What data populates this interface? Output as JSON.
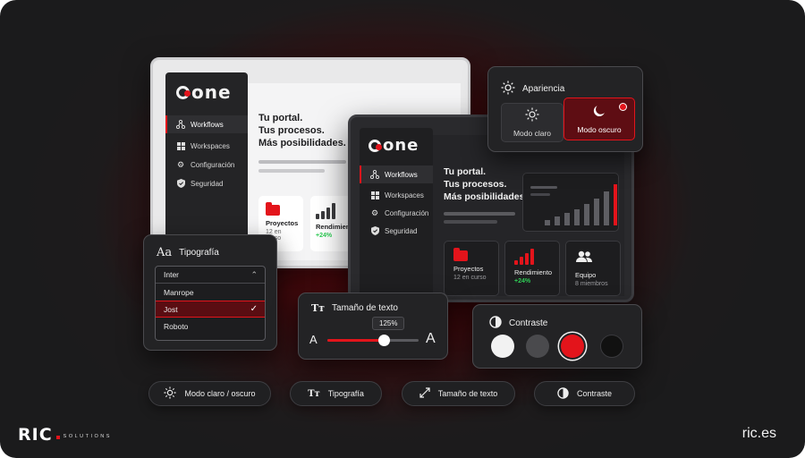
{
  "brand": {
    "app_logo": "one",
    "footer_logo": "RIC",
    "footer_logo_sub": "SOLUTIONS",
    "site": "ric.es",
    "accent_color": "#e3141b"
  },
  "light_window": {
    "nav": [
      {
        "label": "Workflows",
        "icon": "workflow-icon",
        "active": true
      },
      {
        "label": "Workspaces",
        "icon": "grid-icon",
        "active": false
      },
      {
        "label": "Configuración",
        "icon": "gear-icon",
        "active": false
      },
      {
        "label": "Seguridad",
        "icon": "shield-icon",
        "active": false
      }
    ],
    "headline": [
      "Tu portal.",
      "Tus procesos.",
      "Más posibilidades."
    ],
    "cards": [
      {
        "title": "Proyectos",
        "sub": "12 en curso",
        "icon": "folder-icon"
      },
      {
        "title": "Rendimiento",
        "sub": "+24%",
        "icon": "bar-chart-icon"
      }
    ]
  },
  "dark_window": {
    "nav": [
      {
        "label": "Workflows",
        "icon": "workflow-icon",
        "active": true
      },
      {
        "label": "Workspaces",
        "icon": "grid-icon",
        "active": false
      },
      {
        "label": "Configuración",
        "icon": "gear-icon",
        "active": false
      },
      {
        "label": "Seguridad",
        "icon": "shield-icon",
        "active": false
      }
    ],
    "headline": [
      "Tu portal.",
      "Tus procesos.",
      "Más posibilidades."
    ],
    "cards": [
      {
        "title": "Proyectos",
        "sub": "12 en curso",
        "icon": "folder-icon"
      },
      {
        "title": "Rendimiento",
        "sub": "+24%",
        "icon": "bar-chart-icon"
      },
      {
        "title": "Equipo",
        "sub": "8 miembros",
        "icon": "users-icon"
      }
    ]
  },
  "appearance": {
    "title": "Apariencia",
    "light_label": "Modo claro",
    "dark_label": "Modo oscuro",
    "selected": "dark"
  },
  "typography": {
    "title": "Tipografía",
    "title_glyph": "Aa",
    "current": "Inter",
    "options": [
      "Manrope",
      "Jost",
      "Roboto"
    ],
    "selected": "Jost"
  },
  "text_size": {
    "title": "Tamaño de texto",
    "title_glyph": "Tт",
    "value_label": "125%",
    "value_fraction": 0.62,
    "small_glyph": "A",
    "large_glyph": "A"
  },
  "contrast": {
    "title": "Contraste",
    "swatches": [
      "#f2f2f2",
      "#4a4a4d",
      "#e3141b",
      "#111111"
    ],
    "selected_index": 2
  },
  "pills": [
    {
      "label": "Modo claro / oscuro",
      "icon": "sun-icon"
    },
    {
      "label": "Tipografía",
      "icon": "text-icon"
    },
    {
      "label": "Tamaño de texto",
      "icon": "resize-icon"
    },
    {
      "label": "Contraste",
      "icon": "contrast-icon"
    }
  ]
}
